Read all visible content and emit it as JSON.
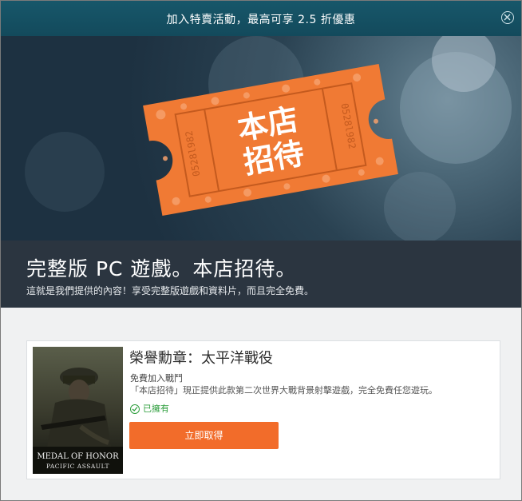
{
  "topbar": {
    "promo_text": "加入特賣活動，最高可享 2.5 折優惠",
    "close_icon": "close-circle-icon"
  },
  "hero": {
    "ticket_line1": "本店",
    "ticket_line2": "招待",
    "ticket_number": "0528l982",
    "ticket_color": "#f07a34"
  },
  "banner": {
    "title": "完整版 PC 遊戲。本店招待。",
    "subtitle": "這就是我們提供的內容！享受完整版遊戲和資料片，而且完全免費。"
  },
  "game": {
    "name": "榮譽勳章：太平洋戰役",
    "subtitle": "免費加入戰鬥",
    "description": "「本店招待」現正提供此款第二次世界大戰背景射擊遊戲，完全免費任您遊玩。",
    "owned_label": "已擁有",
    "cover_title": "MEDAL OF HONOR",
    "cover_subtitle": "PACIFIC ASSAULT",
    "cta_label": "立即取得"
  },
  "colors": {
    "accent": "#f26c2a",
    "owned": "#2e9e3d",
    "topbar": "#134a5c",
    "banner": "#2b3540"
  }
}
